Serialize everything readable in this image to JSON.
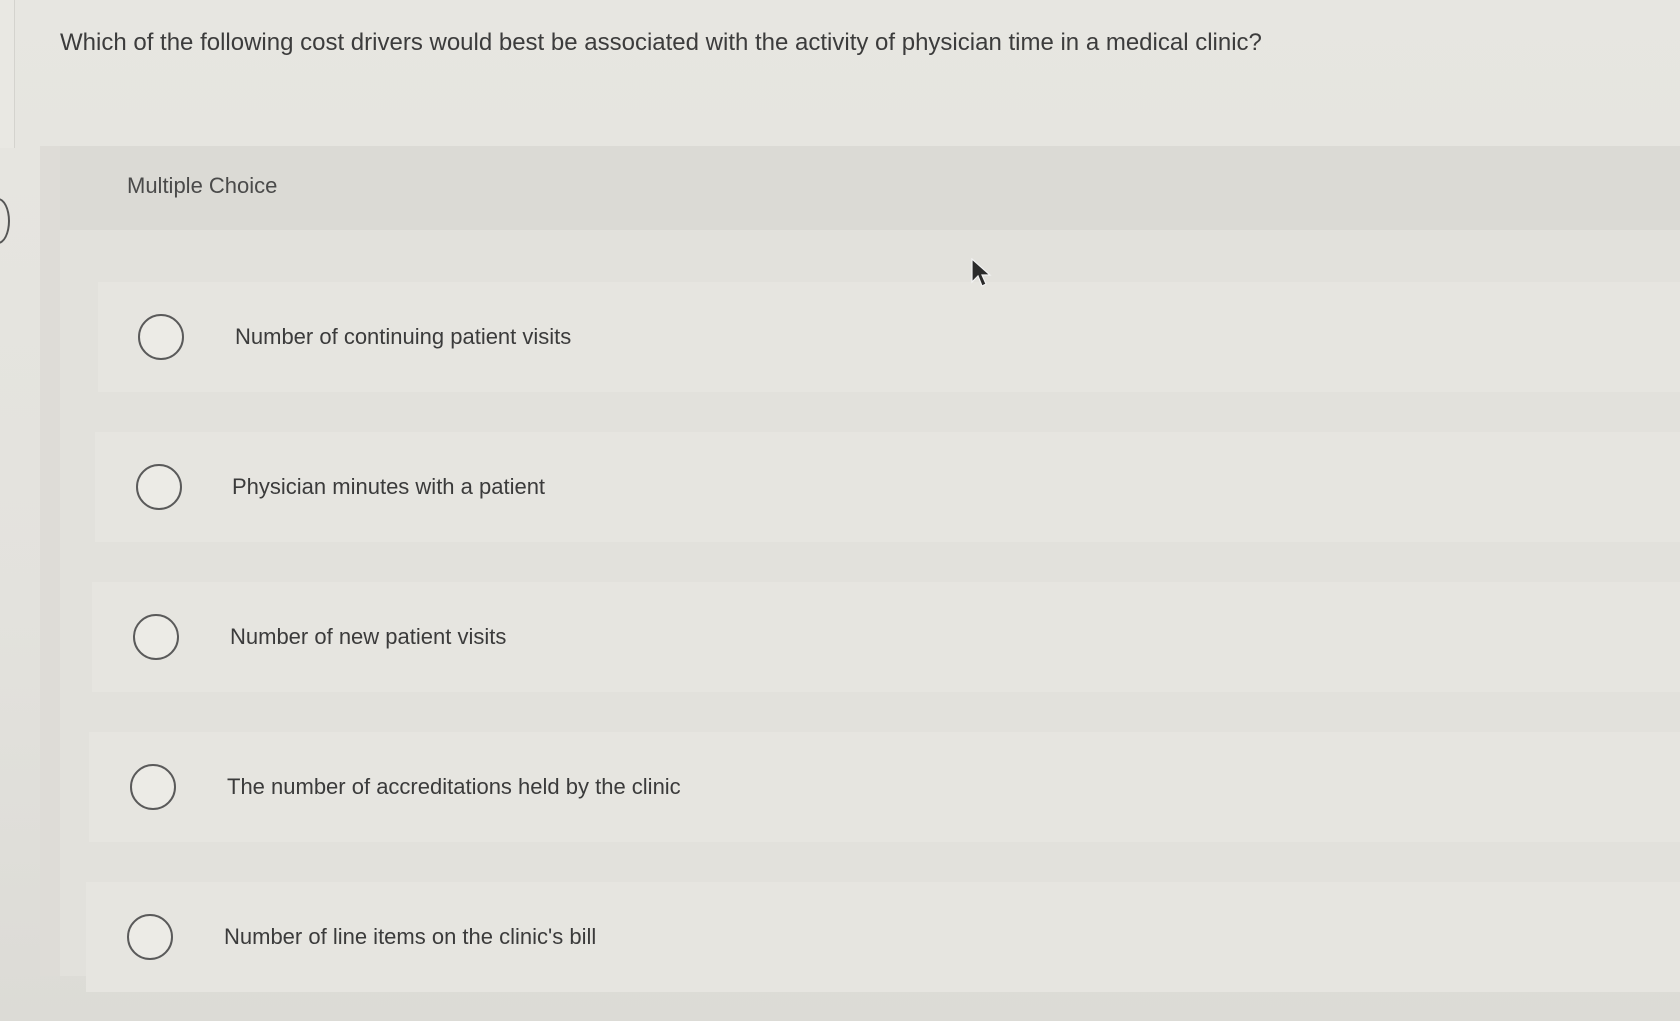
{
  "question": {
    "text": "Which of the following cost drivers would best be associated with the activity of physician time in a medical clinic?"
  },
  "multiple_choice": {
    "label": "Multiple Choice",
    "options": [
      {
        "label": "Number of continuing patient visits",
        "selected": false
      },
      {
        "label": "Physician minutes with a patient",
        "selected": false
      },
      {
        "label": "Number of new patient visits",
        "selected": false
      },
      {
        "label": "The number of accreditations held by the clinic",
        "selected": false
      },
      {
        "label": "Number of line items on the clinic's bill",
        "selected": false
      }
    ]
  },
  "icons": {
    "radio": "radio-unchecked-icon",
    "cursor": "mouse-pointer-icon"
  }
}
